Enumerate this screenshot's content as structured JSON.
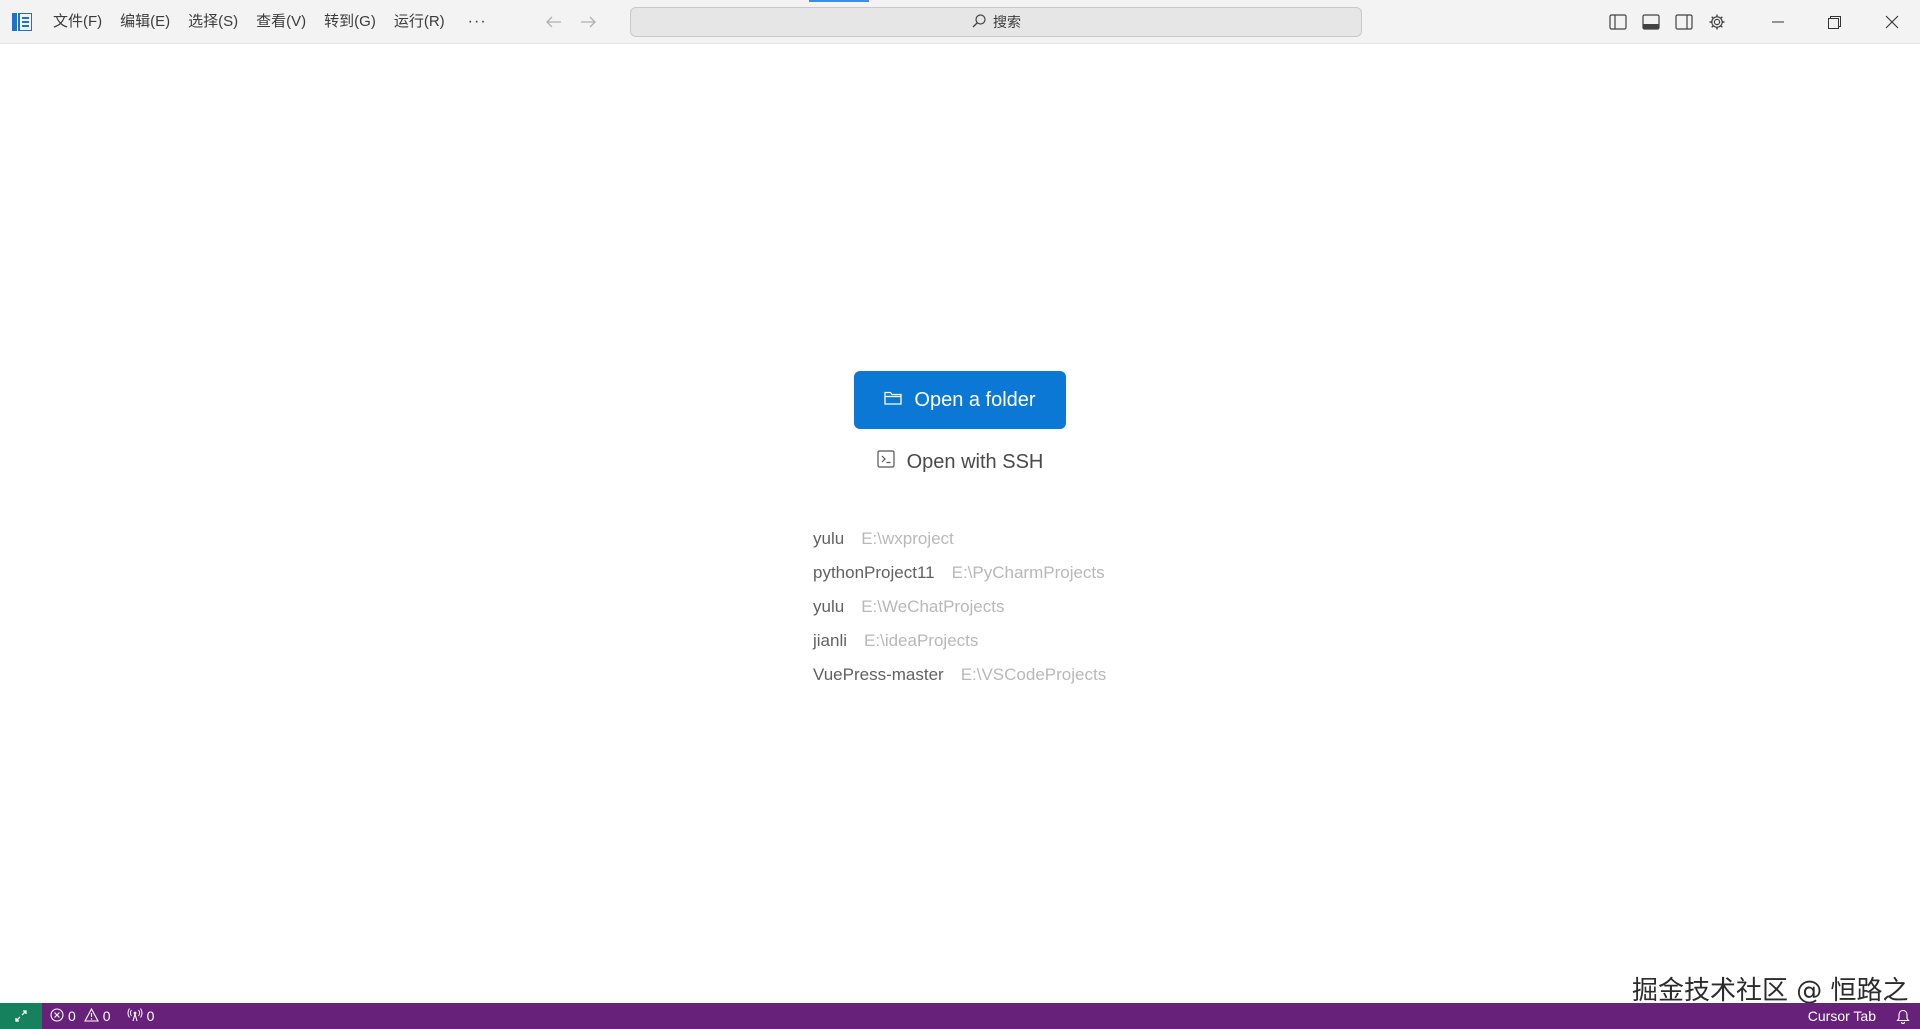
{
  "titlebar": {
    "menu": [
      {
        "label": "文件(F)"
      },
      {
        "label": "编辑(E)"
      },
      {
        "label": "选择(S)"
      },
      {
        "label": "查看(V)"
      },
      {
        "label": "转到(G)"
      },
      {
        "label": "运行(R)"
      }
    ],
    "more_label": "···",
    "search_label": "搜索"
  },
  "main": {
    "open_folder_label": "Open a folder",
    "open_ssh_label": "Open with SSH",
    "recent": [
      {
        "name": "yulu",
        "path": "E:\\wxproject"
      },
      {
        "name": "pythonProject11",
        "path": "E:\\PyCharmProjects"
      },
      {
        "name": "yulu",
        "path": "E:\\WeChatProjects"
      },
      {
        "name": "jianli",
        "path": "E:\\ideaProjects"
      },
      {
        "name": "VuePress-master",
        "path": "E:\\VSCodeProjects"
      }
    ],
    "watermark": "掘金技术社区 @ 恒路之"
  },
  "statusbar": {
    "errors": "0",
    "warnings": "0",
    "ports": "0",
    "cursor_tab_label": "Cursor Tab"
  },
  "colors": {
    "primary_button": "#0a78d4",
    "statusbar_bg": "#68217a",
    "remote_bg": "#16825d"
  }
}
